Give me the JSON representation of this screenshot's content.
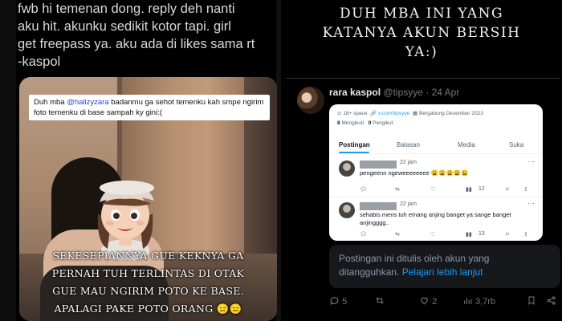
{
  "left_post": {
    "text_lines": [
      "fwb hi temenan dong. reply deh nanti",
      "aku hit. akunku sedikit kotor tapi. girl",
      "get freepass ya. aku ada di likes sama rt",
      "-kaspol"
    ],
    "photo": {
      "caption_top_prefix": "Duh mba ",
      "caption_top_mention": "@halizyzara",
      "caption_top_suffix": " badanmu ga sehot temenku kah smpe ngirim foto temenku di base sampah ky gini:(",
      "caption_bottom_lines": [
        "SEKESEPIANNYA GUE KEKNYA GA",
        "PERNAH TUH TERLINTAS DI OTAK",
        "GUE MAU NGIRIM POTO KE BASE.",
        "APALAGI PAKE POTO ORANG 😑😑"
      ]
    }
  },
  "right_post": {
    "headline_lines": [
      "DUH MBA INI YANG",
      "KATANYA AKUN BERSIH",
      "YA:)"
    ],
    "author": {
      "name": "rara kaspol",
      "handle": "@tipsyye",
      "sep": "·",
      "date": "24 Apr"
    },
    "embedded_profile": {
      "tag": "18+ space",
      "link": "x.com/tipsyye",
      "joined": "Bergabung Desember 2023",
      "following_count": "8",
      "following_label": "Mengikuti",
      "followers_count": "0",
      "followers_label": "Pengikut",
      "tabs": [
        "Postingan",
        "Balasan",
        "Media",
        "Suka"
      ],
      "posts": [
        {
          "time": "22 jam",
          "text": "pengeenn ngeweeeeeeee 😩😩😩😩😩",
          "likes": "12"
        },
        {
          "time": "22 jam",
          "text": "sehabis mens tuh emang anjing banget ya sange banget anjingggg..",
          "likes": "13"
        }
      ]
    },
    "suspended_notice": "Postingan ini ditulis oleh akun yang ditangguhkan.",
    "learn_more": "Pelajari lebih lanjut",
    "actions": {
      "replies": "5",
      "retweets": "",
      "likes": "2",
      "views": "3,7rb"
    }
  }
}
